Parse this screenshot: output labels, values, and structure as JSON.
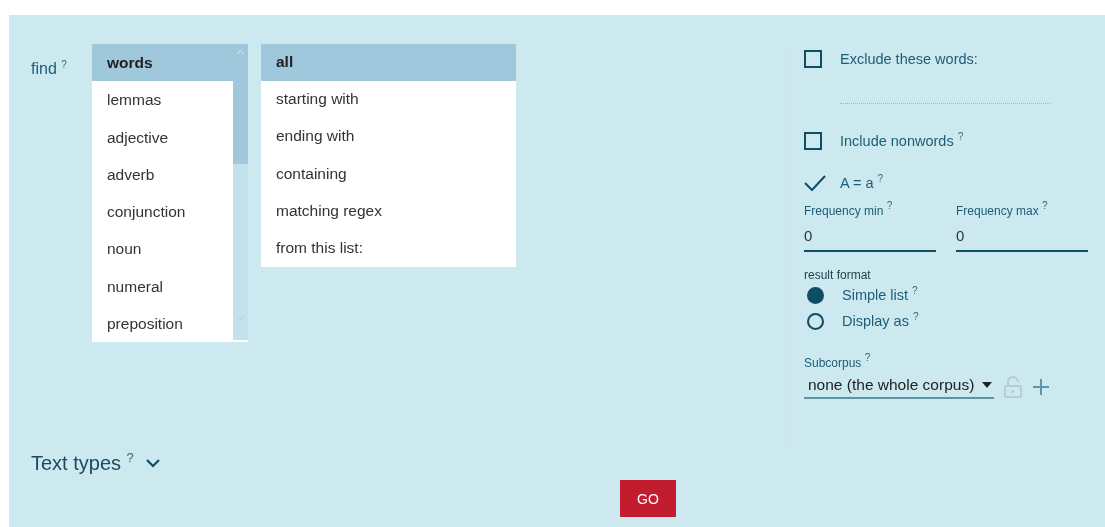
{
  "find": {
    "label": "find $^{?}$"
  },
  "word_types": [
    {
      "label": "words",
      "selected": true
    },
    {
      "label": "lemmas",
      "selected": false
    },
    {
      "label": "adjective",
      "selected": false
    },
    {
      "label": "adverb",
      "selected": false
    },
    {
      "label": "conjunction",
      "selected": false
    },
    {
      "label": "noun",
      "selected": false
    },
    {
      "label": "numeral",
      "selected": false
    },
    {
      "label": "preposition",
      "selected": false
    }
  ],
  "match_modes": [
    {
      "label": "all",
      "selected": true
    },
    {
      "label": "starting with",
      "selected": false
    },
    {
      "label": "ending with",
      "selected": false
    },
    {
      "label": "containing",
      "selected": false
    },
    {
      "label": "matching regex",
      "selected": false
    },
    {
      "label": "from this list:",
      "selected": false
    }
  ],
  "checkboxes": [
    {
      "kind": "with_field",
      "label": "Exclude these words:",
      "checked": false
    },
    {
      "kind": "plain",
      "label": "Include nonwords $^{?}$",
      "checked": false
    },
    {
      "kind": "plain",
      "label": "A = a $^{?}$",
      "checked": true
    }
  ],
  "frequency": [
    {
      "label": "Frequency min $^{?}$",
      "value": "0"
    },
    {
      "label": "Frequency max $^{?}$",
      "value": "0"
    }
  ],
  "result_format": {
    "label": "result format",
    "options": [
      {
        "label": "Simple list $^{?}$",
        "selected": true
      },
      {
        "label": "Display as $^{?}$",
        "selected": false
      }
    ]
  },
  "subcorpus": {
    "label": "Subcorpus $^{?}$",
    "value": "none (the whole corpus)"
  },
  "text_types": {
    "label": "Text types $^{?}$",
    "expanded": false
  },
  "go_button": {
    "label": "GO"
  }
}
